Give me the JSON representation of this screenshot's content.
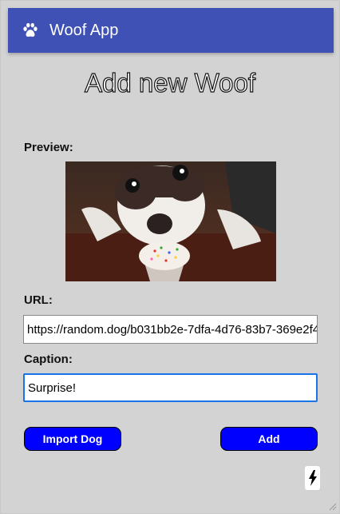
{
  "app": {
    "title": "Woof App",
    "icon": "paw-icon"
  },
  "page": {
    "title": "Add new Woof"
  },
  "form": {
    "preview_label": "Preview:",
    "preview_image": "dog-with-cupcake-image",
    "url_label": "URL:",
    "url_value": "https://random.dog/b031bb2e-7dfa-4d76-83b7-369e2f4",
    "caption_label": "Caption:",
    "caption_value": "Surprise!"
  },
  "actions": {
    "import_label": "Import Dog",
    "add_label": "Add"
  },
  "colors": {
    "appbar": "#3f51b5",
    "button": "#0000ff",
    "background": "#d3d3d3"
  }
}
